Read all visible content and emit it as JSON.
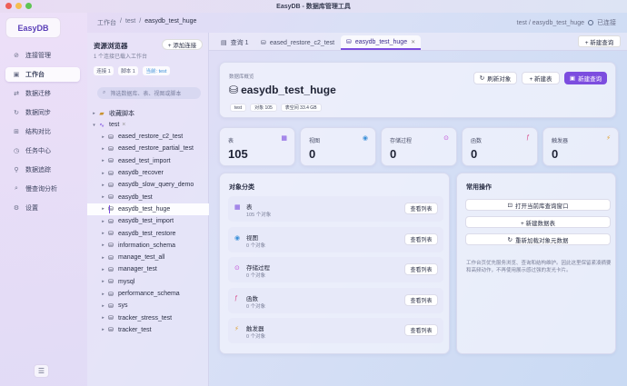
{
  "window": {
    "title": "EasyDB - 数据库管理工具"
  },
  "app": {
    "logo": "EasyDB"
  },
  "nav": {
    "items": [
      {
        "label": "连接管理",
        "icon": "link-icon",
        "glyph": "⊘",
        "active": false
      },
      {
        "label": "工作台",
        "icon": "workbench-icon",
        "glyph": "▣",
        "active": true
      },
      {
        "label": "数据迁移",
        "icon": "migrate-icon",
        "glyph": "⇄",
        "active": false
      },
      {
        "label": "数据同步",
        "icon": "sync-icon",
        "glyph": "↻",
        "active": false
      },
      {
        "label": "结构对比",
        "icon": "compare-icon",
        "glyph": "⊞",
        "active": false
      },
      {
        "label": "任务中心",
        "icon": "task-icon",
        "glyph": "◷",
        "active": false
      },
      {
        "label": "数据追踪",
        "icon": "trace-icon",
        "glyph": "⚲",
        "active": false
      },
      {
        "label": "慢查询分析",
        "icon": "slow-query-icon",
        "glyph": "⌕",
        "active": false
      },
      {
        "label": "设置",
        "icon": "settings-icon",
        "glyph": "⚙",
        "active": false
      }
    ],
    "collapse_icon": "menu-icon"
  },
  "breadcrumb": {
    "part1": "工作台",
    "sep": "/",
    "part2": "test",
    "part3": "easydb_test_huge"
  },
  "status": {
    "path": "test / easydb_test_huge",
    "label": "已连接"
  },
  "explorer": {
    "title": "资源浏览器",
    "subtitle": "1 个连接已载入工作台",
    "add_label": "+ 添加连接",
    "chips": [
      "连接 1",
      "脚本 1",
      "当前: test"
    ],
    "search_placeholder": "筛选数据库、表、视图或脚本",
    "favorites": "收藏脚本",
    "connection": "test",
    "databases": [
      "eased_restore_c2_test",
      "eased_restore_partial_test",
      "eased_test_import",
      "easydb_recover",
      "easydb_slow_query_demo",
      "easydb_test",
      "easydb_test_huge",
      "easydb_test_import",
      "easydb_test_restore",
      "information_schema",
      "manage_test_all",
      "manager_test",
      "mysql",
      "performance_schema",
      "sys",
      "tracker_stress_test",
      "tracker_test"
    ],
    "selected": "easydb_test_huge"
  },
  "tabs": [
    {
      "label": "查询 1",
      "icon": "table-icon",
      "active": false
    },
    {
      "label": "eased_restore_c2_test",
      "icon": "db-icon",
      "active": false
    },
    {
      "label": "easydb_test_huge",
      "icon": "db-icon",
      "active": true
    }
  ],
  "new_query_tab": "+ 新建查询",
  "overview": {
    "label": "数据库概览",
    "title": "easydb_test_huge",
    "tags": [
      "test",
      "对象 105",
      "表空间 33.4 GB"
    ],
    "refresh": "刷新对象",
    "new_table": "+ 新建表",
    "new_query": "新建查询"
  },
  "stats": [
    {
      "label": "表",
      "value": "105",
      "icon": "table-icon",
      "glyph": "▦",
      "color": "#7c4ddf"
    },
    {
      "label": "视图",
      "value": "0",
      "icon": "eye-icon",
      "glyph": "◉",
      "color": "#3a8fd8"
    },
    {
      "label": "存储过程",
      "value": "0",
      "icon": "procedure-icon",
      "glyph": "⊙",
      "color": "#c04fd8"
    },
    {
      "label": "函数",
      "value": "0",
      "icon": "function-icon",
      "glyph": "ƒ",
      "color": "#d84f8f"
    },
    {
      "label": "触发器",
      "value": "0",
      "icon": "bolt-icon",
      "glyph": "⚡",
      "color": "#e0a12f"
    }
  ],
  "categories": {
    "title": "对象分类",
    "view_label": "查看列表",
    "items": [
      {
        "name": "表",
        "count": "105 个对象",
        "icon": "table-icon",
        "glyph": "▦",
        "color": "#7c4ddf"
      },
      {
        "name": "视图",
        "count": "0 个对象",
        "icon": "eye-icon",
        "glyph": "◉",
        "color": "#3a8fd8"
      },
      {
        "name": "存储过程",
        "count": "0 个对象",
        "icon": "procedure-icon",
        "glyph": "⊙",
        "color": "#c04fd8"
      },
      {
        "name": "函数",
        "count": "0 个对象",
        "icon": "function-icon",
        "glyph": "ƒ",
        "color": "#d84f8f"
      },
      {
        "name": "触发器",
        "count": "0 个对象",
        "icon": "bolt-icon",
        "glyph": "⚡",
        "color": "#e0a12f"
      }
    ]
  },
  "quick": {
    "title": "常用操作",
    "actions": [
      "打开当前库查询窗口",
      "+ 新建数据表",
      "重新加载对象元数据"
    ],
    "note": "工作台页优先服务浏览、查询和结构维护。因此这里保留紧凑摘要和高频动作，不再使用展示感过强的发光卡片。"
  }
}
